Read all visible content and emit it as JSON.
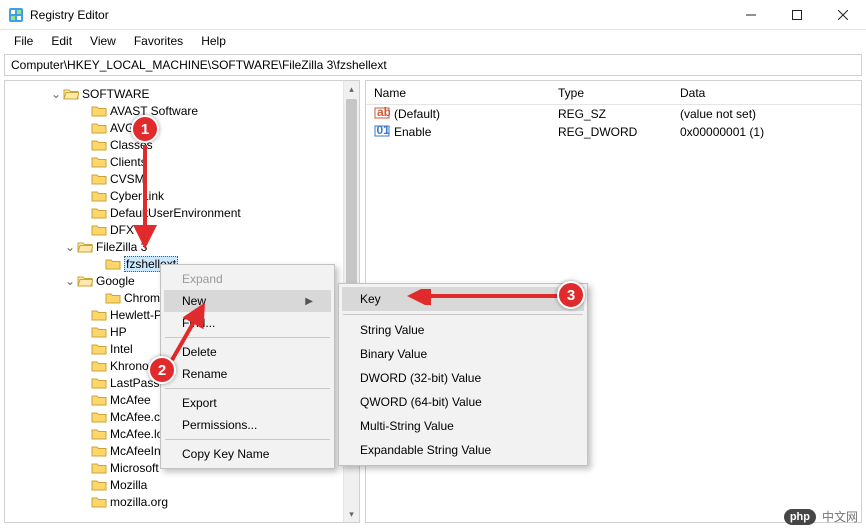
{
  "window": {
    "title": "Registry Editor"
  },
  "menu": {
    "file": "File",
    "edit": "Edit",
    "view": "View",
    "favorites": "Favorites",
    "help": "Help"
  },
  "addressbar": {
    "path": "Computer\\HKEY_LOCAL_MACHINE\\SOFTWARE\\FileZilla 3\\fzshellext"
  },
  "tree": {
    "items": [
      {
        "indent": 44,
        "toggle": "down",
        "open": true,
        "label": "SOFTWARE"
      },
      {
        "indent": 72,
        "toggle": "",
        "open": false,
        "label": "AVAST Software"
      },
      {
        "indent": 72,
        "toggle": "",
        "open": false,
        "label": "AVG"
      },
      {
        "indent": 72,
        "toggle": "",
        "open": false,
        "label": "Classes"
      },
      {
        "indent": 72,
        "toggle": "",
        "open": false,
        "label": "Clients"
      },
      {
        "indent": 72,
        "toggle": "",
        "open": false,
        "label": "CVSM"
      },
      {
        "indent": 72,
        "toggle": "",
        "open": false,
        "label": "CyberLink"
      },
      {
        "indent": 72,
        "toggle": "",
        "open": false,
        "label": "DefaultUserEnvironment"
      },
      {
        "indent": 72,
        "toggle": "",
        "open": false,
        "label": "DFX"
      },
      {
        "indent": 58,
        "toggle": "down",
        "open": true,
        "label": "FileZilla 3"
      },
      {
        "indent": 86,
        "toggle": "",
        "open": false,
        "label": "fzshellext",
        "selected": true
      },
      {
        "indent": 58,
        "toggle": "down",
        "open": true,
        "label": "Google"
      },
      {
        "indent": 86,
        "toggle": "",
        "open": false,
        "label": "Chrome"
      },
      {
        "indent": 72,
        "toggle": "",
        "open": false,
        "label": "Hewlett-Pac"
      },
      {
        "indent": 72,
        "toggle": "",
        "open": false,
        "label": "HP"
      },
      {
        "indent": 72,
        "toggle": "",
        "open": false,
        "label": "Intel"
      },
      {
        "indent": 72,
        "toggle": "",
        "open": false,
        "label": "Khronos"
      },
      {
        "indent": 72,
        "toggle": "",
        "open": false,
        "label": "LastPass"
      },
      {
        "indent": 72,
        "toggle": "",
        "open": false,
        "label": "McAfee"
      },
      {
        "indent": 72,
        "toggle": "",
        "open": false,
        "label": "McAfee.com"
      },
      {
        "indent": 72,
        "toggle": "",
        "open": false,
        "label": "McAfee.logg"
      },
      {
        "indent": 72,
        "toggle": "",
        "open": false,
        "label": "McAfeeInsta"
      },
      {
        "indent": 72,
        "toggle": "",
        "open": false,
        "label": "Microsoft"
      },
      {
        "indent": 72,
        "toggle": "",
        "open": false,
        "label": "Mozilla"
      },
      {
        "indent": 72,
        "toggle": "",
        "open": false,
        "label": "mozilla.org"
      }
    ]
  },
  "list": {
    "headers": {
      "name": "Name",
      "type": "Type",
      "data": "Data"
    },
    "rows": [
      {
        "icon": "sz",
        "name": "(Default)",
        "type": "REG_SZ",
        "data": "(value not set)"
      },
      {
        "icon": "dw",
        "name": "Enable",
        "type": "REG_DWORD",
        "data": "0x00000001 (1)"
      }
    ]
  },
  "context_menu": {
    "expand": "Expand",
    "new": "New",
    "find": "Find...",
    "delete": "Delete",
    "rename": "Rename",
    "export": "Export",
    "permissions": "Permissions...",
    "copy_key_name": "Copy Key Name"
  },
  "submenu": {
    "key": "Key",
    "string": "String Value",
    "binary": "Binary Value",
    "dword": "DWORD (32-bit) Value",
    "qword": "QWORD (64-bit) Value",
    "multi": "Multi-String Value",
    "expandable": "Expandable String Value"
  },
  "annotations": {
    "a1": "1",
    "a2": "2",
    "a3": "3"
  },
  "watermark": {
    "logo": "php",
    "text": "中文网"
  }
}
